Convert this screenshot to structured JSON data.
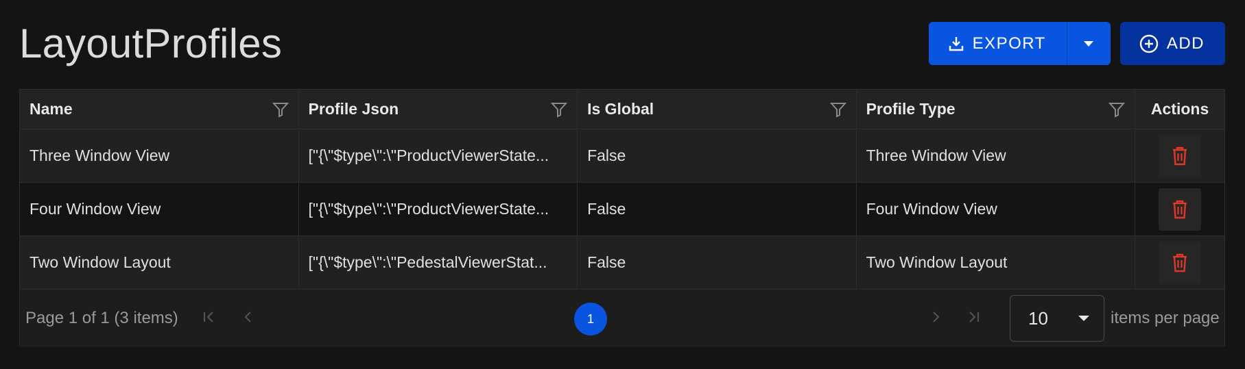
{
  "page": {
    "title": "LayoutProfiles"
  },
  "toolbar": {
    "export_label": "EXPORT",
    "add_label": "ADD"
  },
  "columns": [
    "Name",
    "Profile Json",
    "Is Global",
    "Profile Type",
    "Actions"
  ],
  "rows": [
    {
      "name": "Three Window View",
      "profile_json": "[\"{\\\"$type\\\":\\\"ProductViewerState...",
      "is_global": "False",
      "profile_type": "Three Window View"
    },
    {
      "name": "Four Window View",
      "profile_json": "[\"{\\\"$type\\\":\\\"ProductViewerState...",
      "is_global": "False",
      "profile_type": "Four Window View"
    },
    {
      "name": "Two Window Layout",
      "profile_json": "[\"{\\\"$type\\\":\\\"PedestalViewerStat...",
      "is_global": "False",
      "profile_type": "Two Window Layout"
    }
  ],
  "pager": {
    "info": "Page 1 of 1 (3 items)",
    "current_page": "1",
    "page_size": "10",
    "items_per_page_label": "items per page"
  },
  "icons": {
    "export": "download-icon",
    "dropdown": "caret-down-icon",
    "add": "plus-circle-icon",
    "filter": "filter-icon",
    "delete": "trash-icon",
    "first": "first-page-icon",
    "prev": "chevron-left-icon",
    "next": "chevron-right-icon",
    "last": "last-page-icon"
  },
  "colors": {
    "primary": "#0a55e0",
    "add_button": "#0433a0",
    "delete": "#e0382b",
    "background": "#141414"
  }
}
